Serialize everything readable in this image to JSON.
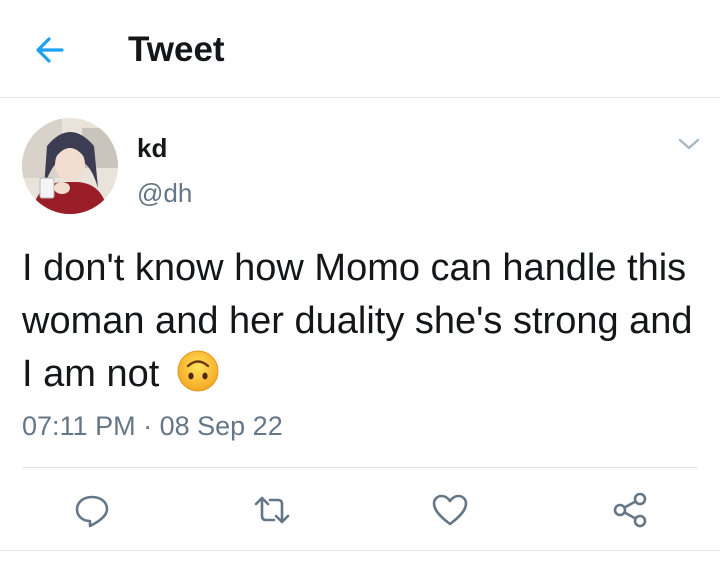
{
  "header": {
    "title": "Tweet",
    "back_icon": "back-arrow-icon"
  },
  "tweet": {
    "author_name": "kd",
    "author_handle": "@dh",
    "text": "I don't know how Momo can handle this woman and her duality she's strong and I am not",
    "emoji": "upside-down-face-emoji",
    "time": "07:11 PM",
    "separator": "·",
    "date": "08 Sep 22"
  },
  "actions": [
    "reply-icon",
    "retweet-icon",
    "like-icon",
    "share-icon"
  ],
  "colors": {
    "accent": "#1da1f2",
    "secondary_text": "#657786",
    "icon_gray": "#657786",
    "divider": "#e1e8ed"
  }
}
